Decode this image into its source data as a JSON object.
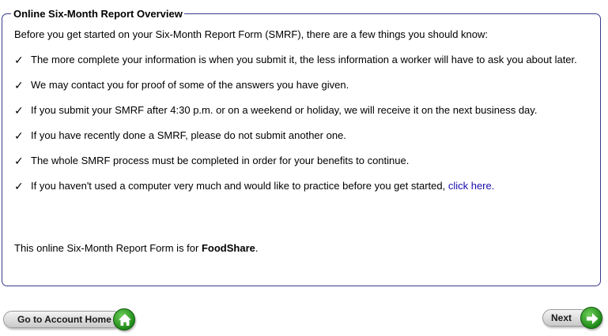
{
  "overview": {
    "title": "Online Six-Month Report Overview",
    "intro": "Before you get started on your Six-Month Report Form (SMRF), there are a few things you should know:",
    "check_glyph": "✓",
    "items": [
      {
        "text": "The more complete your information is when you submit it, the less information a worker will have to ask you about later."
      },
      {
        "text": "We may contact you for proof of some of the answers you have given."
      },
      {
        "text": "If you submit your SMRF after 4:30 p.m. or on a weekend or holiday, we will receive it on the next business day."
      },
      {
        "text": "If you have recently done a SMRF, please do not submit another one."
      },
      {
        "text": "The whole SMRF process must be completed in order for your benefits to continue."
      },
      {
        "text": "If you haven't used a computer very much and would like to practice before you get started, ",
        "link_text": "click here."
      }
    ],
    "program_prefix": "This online Six-Month Report Form is for ",
    "program_name": "FoodShare",
    "program_suffix": "."
  },
  "buttons": {
    "home_label": "Go to Account Home",
    "home_icon": "home-icon",
    "next_label": "Next",
    "next_icon": "arrow-right-icon"
  },
  "colors": {
    "border": "#3a3a8c",
    "link": "#1a0dab",
    "button_green": "#1f8a18"
  }
}
